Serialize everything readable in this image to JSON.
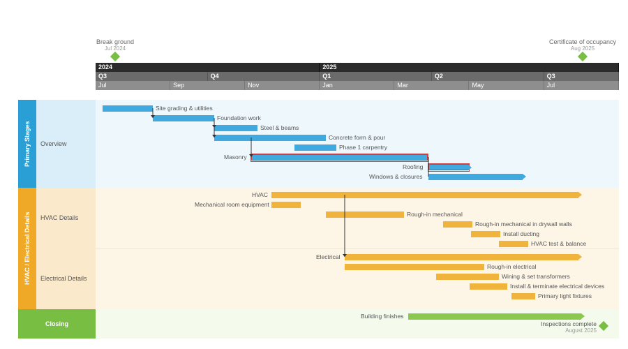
{
  "milestones_top": {
    "start": {
      "label": "Break ground",
      "sub": "Jul 2024"
    },
    "end": {
      "label": "Certificate of occupancy",
      "sub": "Aug 2025"
    }
  },
  "timeline": {
    "years": [
      {
        "label": "2024",
        "frac": 0.4285
      },
      {
        "label": "2025",
        "frac": 0.5715
      }
    ],
    "quarters": [
      {
        "label": "Q3",
        "frac": 0.2142
      },
      {
        "label": "Q4",
        "frac": 0.2142
      },
      {
        "label": "Q1",
        "frac": 0.2142
      },
      {
        "label": "Q2",
        "frac": 0.2142
      },
      {
        "label": "Q3",
        "frac": 0.1432
      }
    ],
    "months": [
      {
        "label": "Jul",
        "frac": 0.1428
      },
      {
        "label": "Sep",
        "frac": 0.1428
      },
      {
        "label": "Nov",
        "frac": 0.1428
      },
      {
        "label": "Jan",
        "frac": 0.1428
      },
      {
        "label": "Mar",
        "frac": 0.1428
      },
      {
        "label": "May",
        "frac": 0.1428
      },
      {
        "label": "Jul",
        "frac": 0.1432
      }
    ]
  },
  "lanes": {
    "primary": {
      "title": "Primary Stages",
      "sublabel": "Overview",
      "tasks": {
        "site_grading": "Site grading & utilities",
        "foundation": "Foundation work",
        "steel": "Steel & beams",
        "concrete": "Concrete form & pour",
        "carpentry": "Phase 1 carpentry",
        "masonry": "Masonry",
        "roofing": "Roofing",
        "windows": "Windows & closures"
      }
    },
    "hvac": {
      "title": "HVAC / Electrical Details",
      "sublabel1": "HVAC Details",
      "sublabel2": "Electrical Details",
      "tasks": {
        "hvac": "HVAC",
        "mech_room": "Mechanical room equipment",
        "rough_mech": "Rough-in mechanical",
        "rough_mech_dw": "Rough-in mechanical in drywall walls",
        "ducting": "Install ducting",
        "test_balance": "HVAC test & balance",
        "electrical": "Electrical",
        "rough_elec": "Rough-in electrical",
        "wiring": "Wining & set transformers",
        "devices": "Install & terminate electrical devices",
        "fixtures": "Primary light fixtures"
      }
    },
    "closing": {
      "title": "Closing",
      "tasks": {
        "finishes": "Building finishes",
        "inspections": "Inspections complete",
        "inspections_sub": "August 2025"
      }
    }
  },
  "chart_data": {
    "type": "bar",
    "title": "Construction project Gantt timeline Jul 2024 – Aug 2025",
    "x_range_months": [
      "2024-07",
      "2025-08"
    ],
    "milestones": [
      {
        "name": "Break ground",
        "date": "2024-07"
      },
      {
        "name": "Certificate of occupancy",
        "date": "2025-08"
      },
      {
        "name": "Inspections complete",
        "date": "2025-08"
      }
    ],
    "series": [
      {
        "group": "Primary Stages",
        "name": "Site grading & utilities",
        "start": "2024-07",
        "end": "2024-08",
        "color": "blue"
      },
      {
        "group": "Primary Stages",
        "name": "Foundation work",
        "start": "2024-08",
        "end": "2024-10",
        "color": "blue"
      },
      {
        "group": "Primary Stages",
        "name": "Steel & beams",
        "start": "2024-10",
        "end": "2024-11",
        "color": "blue"
      },
      {
        "group": "Primary Stages",
        "name": "Concrete form & pour",
        "start": "2024-10",
        "end": "2025-01",
        "color": "blue"
      },
      {
        "group": "Primary Stages",
        "name": "Phase 1 carpentry",
        "start": "2024-12",
        "end": "2025-01",
        "color": "blue"
      },
      {
        "group": "Primary Stages",
        "name": "Masonry",
        "start": "2024-11",
        "end": "2025-04",
        "color": "blue",
        "critical": true
      },
      {
        "group": "Primary Stages",
        "name": "Roofing",
        "start": "2025-04",
        "end": "2025-05",
        "color": "blue",
        "critical": true
      },
      {
        "group": "Primary Stages",
        "name": "Windows & closures",
        "start": "2025-04",
        "end": "2025-07",
        "color": "blue",
        "continues": true
      },
      {
        "group": "HVAC Details",
        "name": "HVAC",
        "start": "2024-11",
        "end": "2025-07",
        "color": "orange",
        "continues": true
      },
      {
        "group": "HVAC Details",
        "name": "Mechanical room equipment",
        "start": "2024-11",
        "end": "2024-12",
        "color": "orange"
      },
      {
        "group": "HVAC Details",
        "name": "Rough-in mechanical",
        "start": "2025-01",
        "end": "2025-03",
        "color": "orange"
      },
      {
        "group": "HVAC Details",
        "name": "Rough-in mechanical in drywall walls",
        "start": "2025-04",
        "end": "2025-05",
        "color": "orange"
      },
      {
        "group": "HVAC Details",
        "name": "Install ducting",
        "start": "2025-05",
        "end": "2025-06",
        "color": "orange"
      },
      {
        "group": "HVAC Details",
        "name": "HVAC test & balance",
        "start": "2025-06",
        "end": "2025-07",
        "color": "orange"
      },
      {
        "group": "Electrical Details",
        "name": "Electrical",
        "start": "2025-01",
        "end": "2025-07",
        "color": "orange",
        "continues": true
      },
      {
        "group": "Electrical Details",
        "name": "Rough-in electrical",
        "start": "2025-01",
        "end": "2025-05",
        "color": "orange"
      },
      {
        "group": "Electrical Details",
        "name": "Wiring & set transformers",
        "start": "2025-04",
        "end": "2025-06",
        "color": "orange"
      },
      {
        "group": "Electrical Details",
        "name": "Install & terminate electrical devices",
        "start": "2025-05",
        "end": "2025-06",
        "color": "orange"
      },
      {
        "group": "Electrical Details",
        "name": "Primary light fixtures",
        "start": "2025-06",
        "end": "2025-07",
        "color": "orange"
      },
      {
        "group": "Closing",
        "name": "Building finishes",
        "start": "2025-03",
        "end": "2025-08",
        "color": "green",
        "continues": true
      }
    ],
    "dependencies": [
      [
        "Site grading & utilities",
        "Foundation work"
      ],
      [
        "Foundation work",
        "Steel & beams"
      ],
      [
        "Foundation work",
        "Concrete form & pour"
      ],
      [
        "Concrete form & pour",
        "Masonry"
      ],
      [
        "Masonry",
        "Roofing"
      ],
      [
        "Masonry",
        "Windows & closures"
      ],
      [
        "HVAC",
        "Electrical"
      ]
    ]
  }
}
